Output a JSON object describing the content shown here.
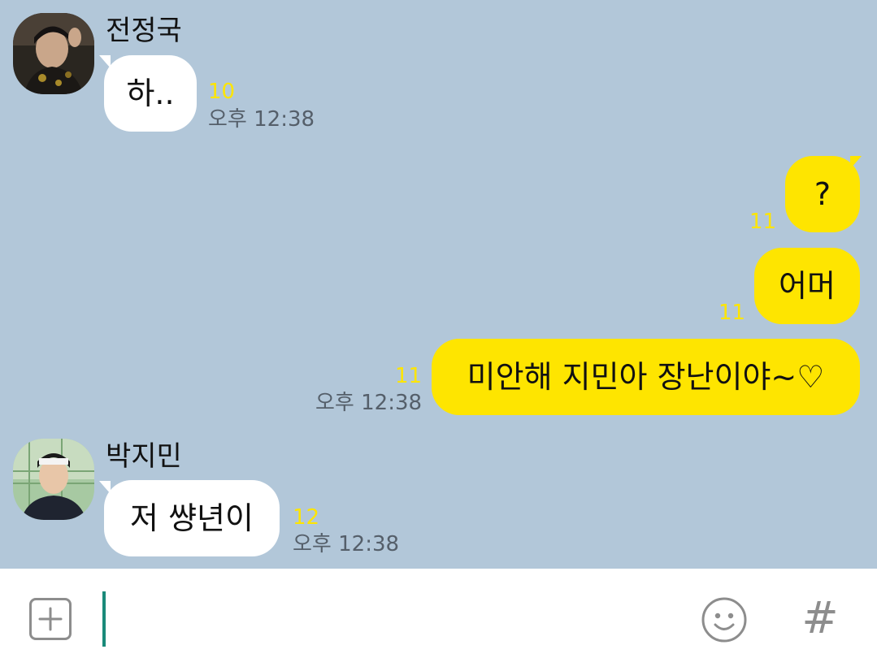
{
  "colors": {
    "chat_background": "#b2c7d9",
    "my_bubble": "#fee500",
    "their_bubble": "#ffffff",
    "unread_count": "#fee500",
    "timestamp": "#555f6a",
    "cursor": "#1a8a7a"
  },
  "messages": [
    {
      "sender": "전정국",
      "text": "하..",
      "unread": "10",
      "time": "오후 12:38"
    },
    {
      "sender": "me",
      "text": "?",
      "unread": "11",
      "time": ""
    },
    {
      "sender": "me",
      "text": "어머",
      "unread": "11",
      "time": ""
    },
    {
      "sender": "me",
      "text": "미안해 지민아 장난이야~♡",
      "unread": "11",
      "time": "오후 12:38"
    },
    {
      "sender": "박지민",
      "text": "저 썅년이",
      "unread": "12",
      "time": "오후 12:38"
    }
  ],
  "input_bar": {
    "add_icon": "plus-square-icon",
    "message_value": "",
    "emoji_icon": "smiley-icon",
    "hash_label": "#"
  }
}
